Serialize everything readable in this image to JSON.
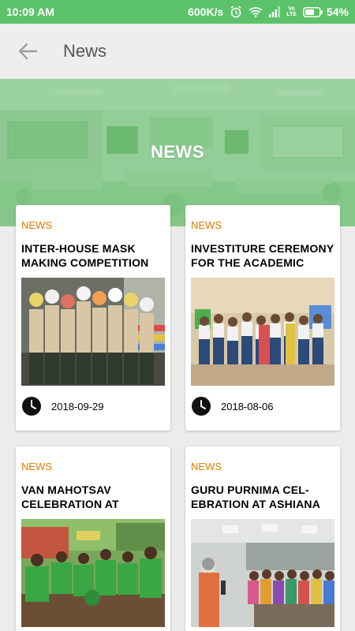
{
  "status_bar": {
    "time": "10:09 AM",
    "speed": "600K/s",
    "network_label": "Vo LTE",
    "battery": "54%"
  },
  "app_bar": {
    "title": "News"
  },
  "hero": {
    "title": "NEWS"
  },
  "news": [
    {
      "category": "NEWS",
      "title": "INTER-HOUSE MASK MAKING COMPETITION",
      "date": "2018-09-29",
      "photo": "students-with-masks"
    },
    {
      "category": "NEWS",
      "title": "INVESTITURE CEREMONY FOR THE ACADEMIC",
      "date": "2018-08-06",
      "photo": "investiture-group"
    },
    {
      "category": "NEWS",
      "title": "VAN MAHOTSAV CELEBRATION AT",
      "date": "",
      "photo": "planting-saplings"
    },
    {
      "category": "NEWS",
      "title": "GURU PURNIMA CEL-EBRATION AT ASHIANA",
      "date": "",
      "photo": "audience-hall"
    }
  ],
  "colors": {
    "status_bar": "#5cc26a",
    "category": "#e07b00",
    "background": "#ececec"
  }
}
